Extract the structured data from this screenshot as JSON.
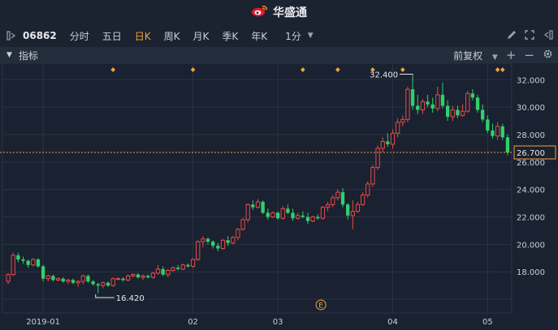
{
  "app": {
    "title": "华盛通"
  },
  "toolbar": {
    "stock_code": "06862",
    "periods": [
      {
        "label": "分时",
        "active": false
      },
      {
        "label": "五日",
        "active": false
      },
      {
        "label": "日K",
        "active": true
      },
      {
        "label": "周K",
        "active": false
      },
      {
        "label": "月K",
        "active": false
      },
      {
        "label": "季K",
        "active": false
      },
      {
        "label": "年K",
        "active": false
      }
    ],
    "interval": "1分"
  },
  "subbar": {
    "indicator_label": "指标",
    "adjust_label": "前复权"
  },
  "colors": {
    "up": "#e84a4a",
    "down": "#2fd16c",
    "accent": "#f0a33a",
    "background": "#1a2130"
  },
  "chart_data": {
    "type": "candlestick",
    "x_tick_labels": [
      "2019-01",
      "02",
      "03",
      "04",
      "05"
    ],
    "y_ticks": [
      16.0,
      18.0,
      20.0,
      22.0,
      24.0,
      26.0,
      28.0,
      30.0,
      32.0
    ],
    "y_tick_labels": [
      "",
      "18.000",
      "20.000",
      "22.000",
      "24.000",
      "26.000",
      "28.000",
      "30.000",
      "32.000"
    ],
    "ylim": [
      15.0,
      33.2
    ],
    "current_price": 26.7,
    "current_price_label": "26.700",
    "max_label": "32.400",
    "min_label": "16.420",
    "event_marker": "E",
    "candles": [
      [
        0,
        17.3,
        17.9,
        17.1,
        17.8
      ],
      [
        1,
        17.8,
        19.4,
        17.7,
        19.2
      ],
      [
        2,
        19.2,
        19.4,
        18.7,
        18.9
      ],
      [
        3,
        18.9,
        19.1,
        18.6,
        18.8
      ],
      [
        4,
        18.8,
        18.9,
        18.3,
        18.5
      ],
      [
        5,
        18.5,
        19.0,
        18.4,
        18.9
      ],
      [
        6,
        18.9,
        19.0,
        18.3,
        18.4
      ],
      [
        7,
        18.4,
        18.5,
        17.3,
        17.5
      ],
      [
        8,
        17.5,
        17.8,
        17.3,
        17.7
      ],
      [
        9,
        17.7,
        17.8,
        17.3,
        17.4
      ],
      [
        10,
        17.4,
        17.6,
        17.3,
        17.5
      ],
      [
        11,
        17.5,
        17.6,
        17.2,
        17.3
      ],
      [
        12,
        17.3,
        17.5,
        17.1,
        17.4
      ],
      [
        13,
        17.4,
        17.5,
        17.1,
        17.2
      ],
      [
        14,
        17.2,
        17.4,
        16.9,
        17.3
      ],
      [
        15,
        17.3,
        17.8,
        17.1,
        17.7
      ],
      [
        16,
        17.7,
        17.8,
        17.2,
        17.3
      ],
      [
        17,
        17.3,
        17.4,
        17.0,
        17.1
      ],
      [
        18,
        17.1,
        17.2,
        16.42,
        17.0
      ],
      [
        19,
        17.0,
        17.3,
        16.8,
        17.2
      ],
      [
        20,
        17.2,
        17.3,
        16.9,
        17.0
      ],
      [
        21,
        17.0,
        17.6,
        16.9,
        17.5
      ],
      [
        22,
        17.5,
        17.6,
        17.4,
        17.5
      ],
      [
        23,
        17.5,
        17.6,
        17.3,
        17.4
      ],
      [
        24,
        17.4,
        17.8,
        17.3,
        17.7
      ],
      [
        25,
        17.7,
        17.9,
        17.6,
        17.8
      ],
      [
        26,
        17.8,
        17.9,
        17.5,
        17.6
      ],
      [
        27,
        17.6,
        17.8,
        17.4,
        17.7
      ],
      [
        28,
        17.7,
        17.8,
        17.5,
        17.6
      ],
      [
        29,
        17.6,
        18.0,
        17.5,
        17.9
      ],
      [
        30,
        17.9,
        18.5,
        17.8,
        18.2
      ],
      [
        31,
        18.2,
        18.4,
        17.7,
        17.8
      ],
      [
        32,
        17.8,
        18.2,
        17.6,
        18.1
      ],
      [
        33,
        18.1,
        18.4,
        18.0,
        18.3
      ],
      [
        34,
        18.3,
        18.5,
        18.1,
        18.2
      ],
      [
        35,
        18.2,
        18.6,
        18.1,
        18.5
      ],
      [
        36,
        18.5,
        18.6,
        18.3,
        18.4
      ],
      [
        37,
        18.4,
        19.0,
        18.3,
        18.9
      ],
      [
        38,
        18.9,
        20.3,
        18.8,
        20.2
      ],
      [
        39,
        20.2,
        20.6,
        19.8,
        20.4
      ],
      [
        40,
        20.4,
        20.5,
        20.0,
        20.2
      ],
      [
        41,
        20.2,
        20.3,
        19.7,
        19.9
      ],
      [
        42,
        19.9,
        20.1,
        19.5,
        19.7
      ],
      [
        43,
        19.7,
        20.4,
        19.6,
        20.3
      ],
      [
        44,
        20.3,
        20.6,
        19.9,
        20.1
      ],
      [
        45,
        20.1,
        20.6,
        20.0,
        20.5
      ],
      [
        46,
        20.5,
        21.2,
        20.3,
        21.1
      ],
      [
        47,
        21.1,
        21.9,
        21.0,
        21.8
      ],
      [
        48,
        21.8,
        23.0,
        21.6,
        22.9
      ],
      [
        49,
        22.9,
        23.2,
        22.5,
        22.7
      ],
      [
        50,
        22.7,
        23.3,
        22.6,
        23.1
      ],
      [
        51,
        23.1,
        23.2,
        22.2,
        22.3
      ],
      [
        52,
        22.3,
        22.6,
        21.8,
        22.0
      ],
      [
        53,
        22.0,
        22.4,
        21.9,
        22.3
      ],
      [
        54,
        22.3,
        22.4,
        21.8,
        21.9
      ],
      [
        55,
        21.9,
        22.8,
        21.8,
        22.6
      ],
      [
        56,
        22.6,
        22.9,
        22.2,
        22.3
      ],
      [
        57,
        22.3,
        22.6,
        21.7,
        21.9
      ],
      [
        58,
        21.9,
        22.3,
        21.8,
        22.1
      ],
      [
        59,
        22.1,
        22.4,
        21.9,
        22.0
      ],
      [
        60,
        22.0,
        22.3,
        21.5,
        21.7
      ],
      [
        61,
        21.7,
        22.1,
        21.6,
        22.0
      ],
      [
        62,
        22.0,
        22.2,
        21.8,
        21.9
      ],
      [
        63,
        21.9,
        22.8,
        21.8,
        22.7
      ],
      [
        64,
        22.7,
        23.1,
        22.4,
        22.9
      ],
      [
        65,
        22.9,
        23.6,
        22.7,
        23.4
      ],
      [
        66,
        23.4,
        24.0,
        23.2,
        23.8
      ],
      [
        67,
        23.8,
        24.1,
        22.7,
        22.9
      ],
      [
        68,
        22.9,
        23.0,
        21.8,
        22.1
      ],
      [
        69,
        22.1,
        23.2,
        21.1,
        22.4
      ],
      [
        70,
        22.4,
        23.1,
        22.3,
        22.9
      ],
      [
        71,
        22.9,
        23.8,
        22.8,
        23.6
      ],
      [
        72,
        23.6,
        24.6,
        23.4,
        24.4
      ],
      [
        73,
        24.4,
        25.8,
        24.2,
        25.6
      ],
      [
        74,
        25.6,
        27.2,
        25.4,
        27.0
      ],
      [
        75,
        27.0,
        27.8,
        26.7,
        27.5
      ],
      [
        76,
        27.5,
        28.1,
        27.1,
        27.3
      ],
      [
        77,
        27.3,
        28.4,
        27.0,
        28.1
      ],
      [
        78,
        28.1,
        29.2,
        27.8,
        28.9
      ],
      [
        79,
        28.9,
        29.4,
        28.6,
        29.1
      ],
      [
        80,
        29.1,
        31.5,
        28.9,
        31.3
      ],
      [
        81,
        31.3,
        32.4,
        29.8,
        30.1
      ],
      [
        82,
        30.1,
        30.9,
        29.5,
        29.8
      ],
      [
        83,
        29.8,
        30.6,
        29.5,
        30.4
      ],
      [
        84,
        30.4,
        30.9,
        30.0,
        30.2
      ],
      [
        85,
        30.2,
        30.7,
        29.6,
        29.9
      ],
      [
        86,
        29.9,
        31.5,
        29.7,
        30.9
      ],
      [
        87,
        30.9,
        31.8,
        29.9,
        30.1
      ],
      [
        88,
        30.1,
        30.5,
        29.0,
        29.3
      ],
      [
        89,
        29.3,
        30.1,
        29.0,
        29.8
      ],
      [
        90,
        29.8,
        30.1,
        29.2,
        29.4
      ],
      [
        91,
        29.4,
        30.2,
        29.3,
        29.7
      ],
      [
        92,
        29.7,
        31.2,
        29.6,
        31.0
      ],
      [
        93,
        31.0,
        31.3,
        30.5,
        30.7
      ],
      [
        94,
        30.7,
        30.9,
        29.6,
        29.8
      ],
      [
        95,
        29.8,
        30.2,
        28.9,
        29.1
      ],
      [
        96,
        29.1,
        29.4,
        28.1,
        28.3
      ],
      [
        97,
        28.3,
        28.8,
        27.7,
        27.9
      ],
      [
        98,
        27.9,
        28.9,
        27.6,
        28.6
      ],
      [
        99,
        28.6,
        28.8,
        27.6,
        27.8
      ],
      [
        100,
        27.8,
        28.0,
        26.5,
        26.7
      ]
    ]
  }
}
